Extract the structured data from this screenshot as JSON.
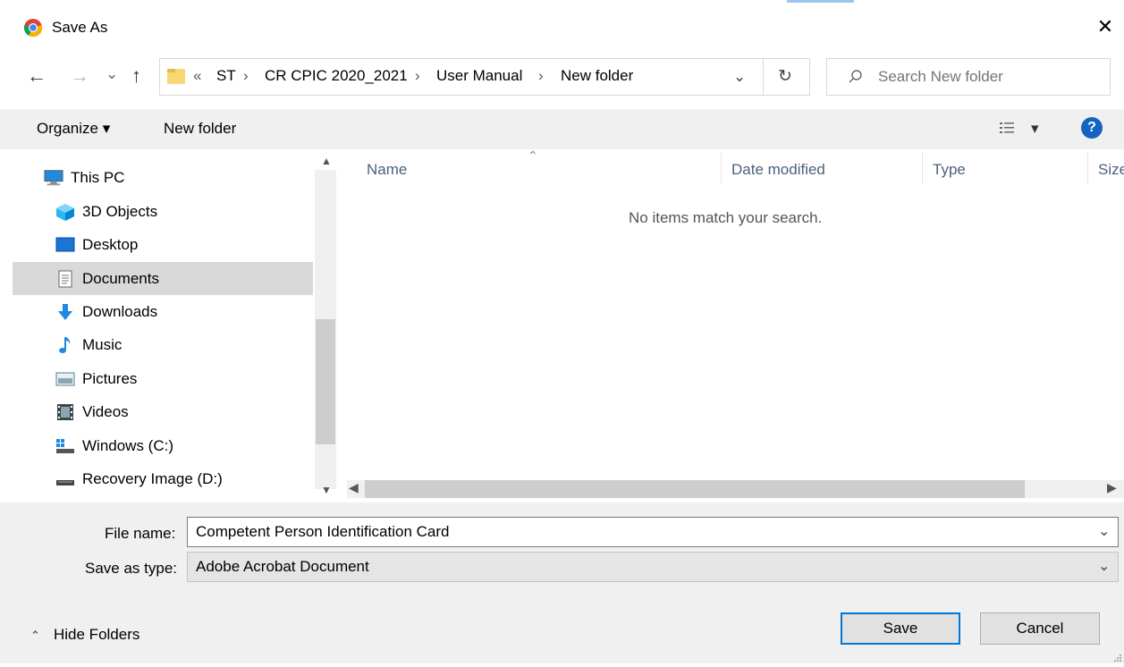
{
  "window": {
    "title": "Save As",
    "close_glyph": "✕"
  },
  "nav": {
    "back": "←",
    "forward": "→",
    "recent": "⌄",
    "up": "↑"
  },
  "address": {
    "overflow": "«",
    "crumbs": [
      "ST",
      "CR CPIC 2020_2021",
      "User Manual",
      "New folder"
    ],
    "sep": "›",
    "dropdown": "⌄",
    "refresh": "↻"
  },
  "search": {
    "placeholder": "Search New folder"
  },
  "toolbar": {
    "organize": "Organize ▾",
    "new_folder": "New folder",
    "view_caret": "▾",
    "help": "?"
  },
  "sidebar": {
    "items": [
      {
        "label": "This PC",
        "icon": "computer-icon"
      },
      {
        "label": "3D Objects",
        "icon": "3d-objects-icon"
      },
      {
        "label": "Desktop",
        "icon": "desktop-icon"
      },
      {
        "label": "Documents",
        "icon": "documents-icon"
      },
      {
        "label": "Downloads",
        "icon": "downloads-icon"
      },
      {
        "label": "Music",
        "icon": "music-icon"
      },
      {
        "label": "Pictures",
        "icon": "pictures-icon"
      },
      {
        "label": "Videos",
        "icon": "videos-icon"
      },
      {
        "label": "Windows (C:)",
        "icon": "drive-c-icon"
      },
      {
        "label": "Recovery Image (D:)",
        "icon": "drive-d-icon"
      }
    ],
    "selected": "Documents"
  },
  "columns": {
    "name": "Name",
    "date": "Date modified",
    "type": "Type",
    "size": "Size"
  },
  "content": {
    "empty_message": "No items match your search."
  },
  "form": {
    "file_name_label": "File name:",
    "file_name_value": "Competent Person Identification Card",
    "save_type_label": "Save as type:",
    "save_type_value": "Adobe Acrobat Document"
  },
  "footer": {
    "hide_folders": "Hide Folders",
    "save": "Save",
    "cancel": "Cancel"
  },
  "colors": {
    "accent": "#0078d7",
    "selection": "#d9d9d9",
    "panel": "#f0f0f0"
  }
}
